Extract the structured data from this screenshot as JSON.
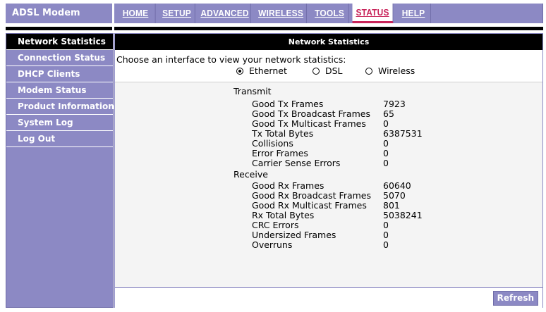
{
  "brand": "ADSL Modem",
  "nav": {
    "tabs": [
      {
        "label": "HOME"
      },
      {
        "label": "SETUP"
      },
      {
        "label": "ADVANCED"
      },
      {
        "label": "WIRELESS"
      },
      {
        "label": "TOOLS"
      },
      {
        "label": "STATUS",
        "active": true
      },
      {
        "label": "HELP"
      }
    ]
  },
  "sidebar": {
    "items": [
      {
        "label": "Network Statistics",
        "active": true
      },
      {
        "label": "Connection Status"
      },
      {
        "label": "DHCP Clients"
      },
      {
        "label": "Modem Status"
      },
      {
        "label": "Product Information"
      },
      {
        "label": "System Log"
      },
      {
        "label": "Log Out"
      }
    ]
  },
  "main": {
    "title": "Network Statistics",
    "prompt": "Choose an interface to view your network statistics:",
    "interfaces": [
      {
        "label": "Ethernet",
        "selected": true
      },
      {
        "label": "DSL",
        "selected": false
      },
      {
        "label": "Wireless",
        "selected": false
      }
    ],
    "transmit": {
      "title": "Transmit",
      "rows": [
        {
          "label": "Good Tx Frames",
          "value": "7923"
        },
        {
          "label": "Good Tx Broadcast Frames",
          "value": "65"
        },
        {
          "label": "Good Tx Multicast Frames",
          "value": "0"
        },
        {
          "label": "Tx Total Bytes",
          "value": "6387531"
        },
        {
          "label": "Collisions",
          "value": "0"
        },
        {
          "label": "Error Frames",
          "value": "0"
        },
        {
          "label": "Carrier Sense Errors",
          "value": "0"
        }
      ]
    },
    "receive": {
      "title": "Receive",
      "rows": [
        {
          "label": "Good Rx Frames",
          "value": "60640"
        },
        {
          "label": "Good Rx Broadcast Frames",
          "value": "5070"
        },
        {
          "label": "Good Rx Multicast Frames",
          "value": "801"
        },
        {
          "label": "Rx Total Bytes",
          "value": "5038241"
        },
        {
          "label": "CRC Errors",
          "value": "0"
        },
        {
          "label": "Undersized Frames",
          "value": "0"
        },
        {
          "label": "Overruns",
          "value": "0"
        }
      ]
    },
    "refresh_label": "Refresh"
  },
  "colors": {
    "accent": "#8c89c4",
    "active_tab_text": "#c8245a",
    "header_black": "#000000"
  }
}
